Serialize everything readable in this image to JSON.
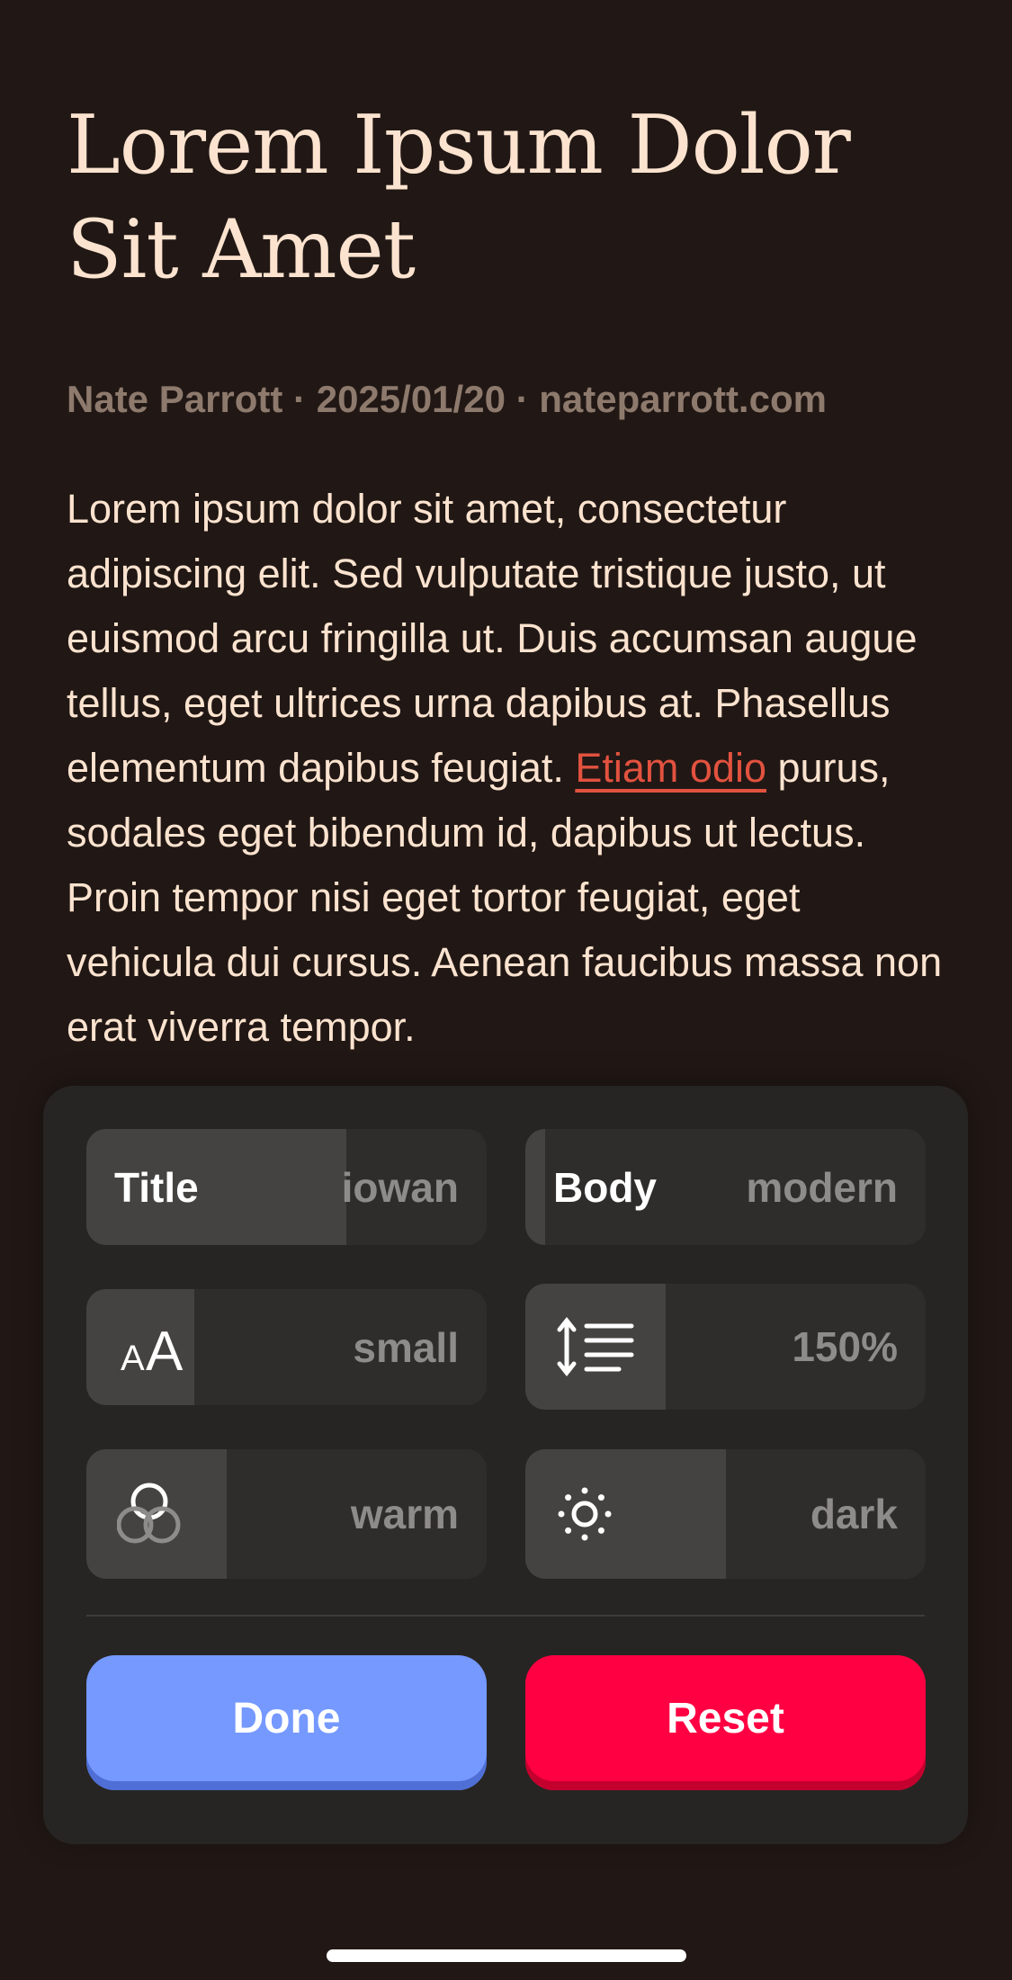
{
  "article": {
    "title": "Lorem Ipsum Dolor Sit Amet",
    "byline": "Nate Parrott · 2025/01/20 · nateparrott.com",
    "body_before_link": "Lorem ipsum dolor sit amet, consectetur adipiscing elit. Sed vulputate tristique justo, ut euismod arcu fringilla ut. Duis accumsan augue tellus, eget ultrices urna dapibus at. Phasellus elementum dapibus feugiat. ",
    "link_text": "Etiam odio",
    "body_after_link": " purus, sodales eget bibendum id, dapibus ut lectus. Proin tempor nisi eget tortor feugiat, eget vehicula dui cursus. Aenean faucibus massa non erat viverra tempor."
  },
  "settings": {
    "title_font": {
      "label": "Title",
      "value": "iowan",
      "level": 0.65
    },
    "body_font": {
      "label": "Body",
      "value": "modern",
      "level": 0.05
    },
    "text_size": {
      "icon": "text-size-icon",
      "value": "small",
      "level": 0.27
    },
    "line_height": {
      "icon": "line-spacing-icon",
      "value": "150%",
      "level": 0.35
    },
    "color_tone": {
      "icon": "color-circles-icon",
      "value": "warm",
      "level": 0.35
    },
    "theme": {
      "icon": "sun-icon",
      "value": "dark",
      "level": 0.5
    }
  },
  "actions": {
    "done_label": "Done",
    "reset_label": "Reset"
  },
  "colors": {
    "background": "#211815",
    "text": "#FCE3CF",
    "link": "#E2523F",
    "panel": "#272523",
    "done": "#7599FF",
    "reset": "#FF0043"
  }
}
